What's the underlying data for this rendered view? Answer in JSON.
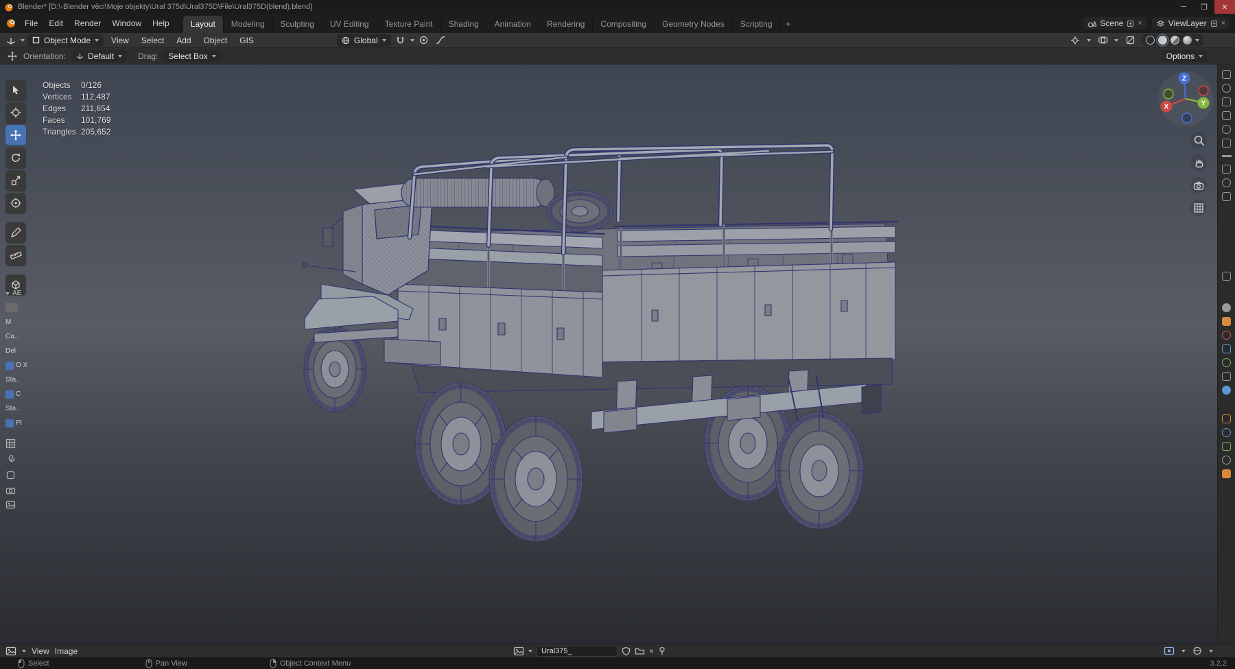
{
  "window": {
    "title": "Blender* [D:\\-Blender věci\\Moje objekty\\Ural 375d\\Ural375D\\File\\Ural375D(blend).blend]"
  },
  "menubar": {
    "menus": [
      {
        "label": "File"
      },
      {
        "label": "Edit"
      },
      {
        "label": "Render"
      },
      {
        "label": "Window"
      },
      {
        "label": "Help"
      }
    ],
    "workspaces": [
      {
        "label": "Layout",
        "active": true
      },
      {
        "label": "Modeling"
      },
      {
        "label": "Sculpting"
      },
      {
        "label": "UV Editing"
      },
      {
        "label": "Texture Paint"
      },
      {
        "label": "Shading"
      },
      {
        "label": "Animation"
      },
      {
        "label": "Rendering"
      },
      {
        "label": "Compositing"
      },
      {
        "label": "Geometry Nodes"
      },
      {
        "label": "Scripting"
      }
    ],
    "add_workspace": "+",
    "scene": {
      "label": "Scene"
    },
    "view_layer": {
      "label": "ViewLayer"
    }
  },
  "viewport_header": {
    "mode": "Object Mode",
    "menus": [
      {
        "label": "View"
      },
      {
        "label": "Select"
      },
      {
        "label": "Add"
      },
      {
        "label": "Object"
      },
      {
        "label": "GIS"
      }
    ],
    "orientation": "Global"
  },
  "tool_settings": {
    "orientation_label": "Orientation:",
    "orientation_value": "Default",
    "drag_label": "Drag:",
    "drag_value": "Select Box",
    "options_label": "Options"
  },
  "stats": {
    "rows": [
      {
        "label": "Objects",
        "value": "0/126"
      },
      {
        "label": "Vertices",
        "value": "112,487"
      },
      {
        "label": "Edges",
        "value": "211,654"
      },
      {
        "label": "Faces",
        "value": "101,769"
      },
      {
        "label": "Triangles",
        "value": "205,652"
      }
    ]
  },
  "side_panel": {
    "header": "AE",
    "items": [
      {
        "label": "M"
      },
      {
        "label": "Ca.."
      },
      {
        "label": "Del"
      },
      {
        "label": "O X"
      },
      {
        "label": "Sta.."
      },
      {
        "label": "C"
      },
      {
        "label": "Sta.."
      },
      {
        "label": "Pl"
      }
    ]
  },
  "axis_gizmo": {
    "x": "X",
    "y": "Y",
    "z": "Z"
  },
  "image_editor": {
    "menus": [
      {
        "label": "View"
      },
      {
        "label": "Image"
      }
    ],
    "image_name": "Ural375_"
  },
  "status_bar": {
    "hints": [
      {
        "label": "Select"
      },
      {
        "label": "Pan View"
      },
      {
        "label": "Object Context Menu"
      }
    ],
    "version": "3.2.2"
  },
  "colors": {
    "accent": "#4772b3",
    "axis_x": "#cc4a43",
    "axis_y": "#84b73f",
    "axis_z": "#4a6fd6"
  }
}
